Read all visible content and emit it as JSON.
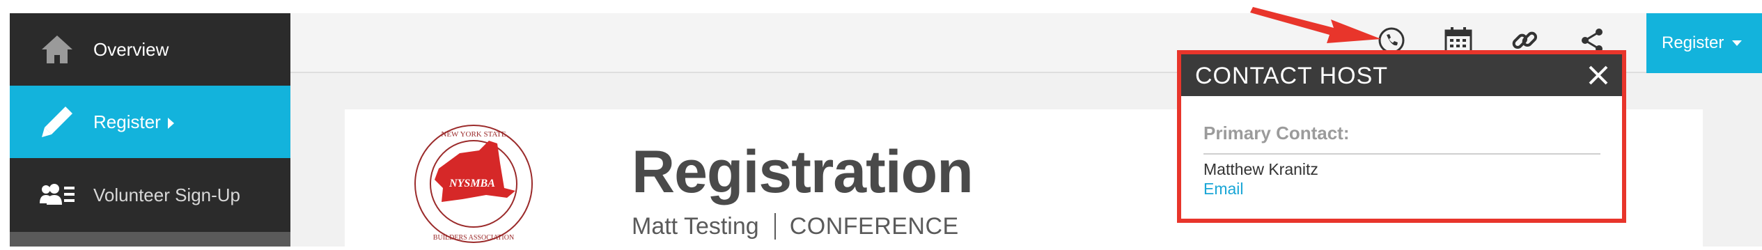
{
  "sidebar": {
    "items": [
      {
        "label": "Overview",
        "icon": "home-icon"
      },
      {
        "label": "Register",
        "icon": "pencil-icon"
      },
      {
        "label": "Volunteer Sign-Up",
        "icon": "volunteer-icon"
      }
    ]
  },
  "toolbar": {
    "icons": [
      "phone-icon",
      "calendar-icon",
      "link-icon",
      "share-icon"
    ],
    "register_label": "Register"
  },
  "event": {
    "logo_text": "NEW YORK STATE · NYSMBA · MONUMENT BUILDERS ASSOCIATION",
    "title": "Registration",
    "host": "Matt Testing",
    "type": "CONFERENCE"
  },
  "contact_popup": {
    "title": "CONTACT HOST",
    "primary_label": "Primary Contact:",
    "name": "Matthew Kranitz",
    "email_label": "Email"
  },
  "colors": {
    "accent": "#13b3dc",
    "sidebar_bg": "#2b2b2b",
    "annotation_red": "#e8352b",
    "popup_header": "#3b3b3b"
  }
}
